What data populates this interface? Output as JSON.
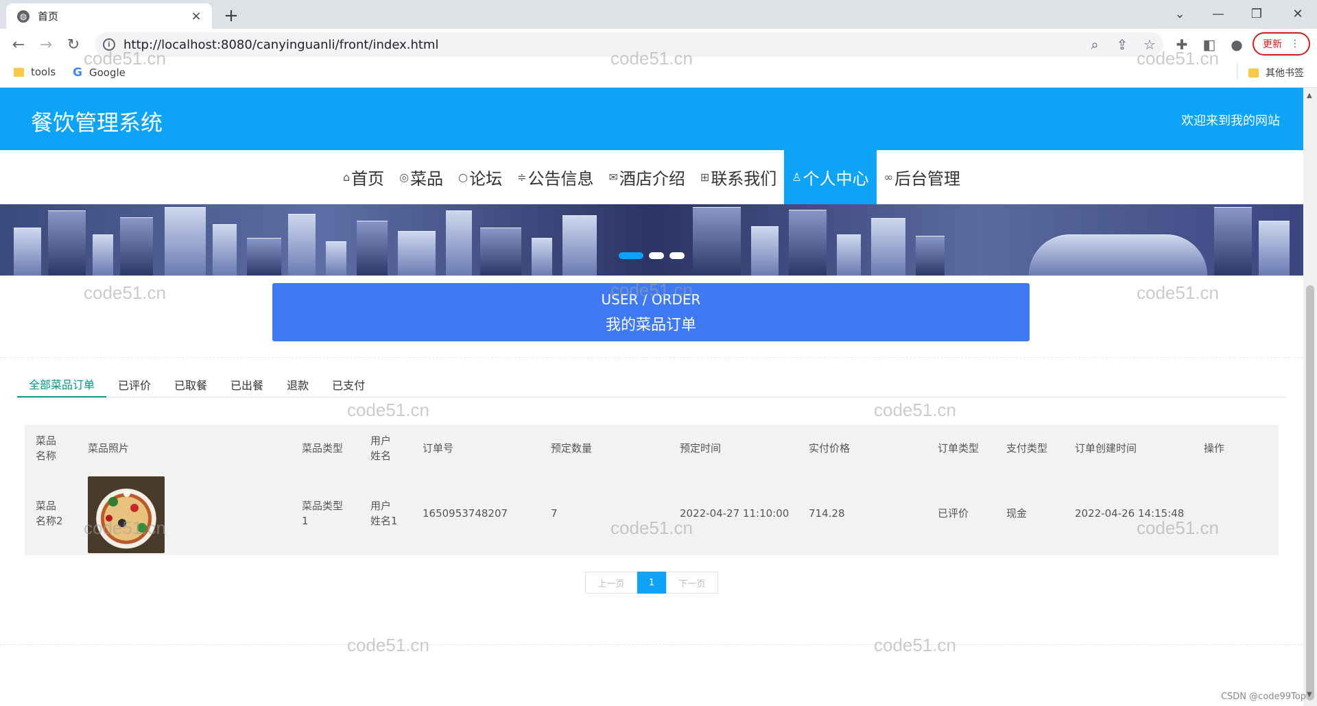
{
  "browser": {
    "tab_title": "首页",
    "tab_close": "×",
    "new_tab": "+",
    "url": "http://localhost:8080/canyinguanli/front/index.html",
    "update_label": "更新",
    "bookmarks": [
      {
        "label": "tools",
        "icon": "folder-icon"
      },
      {
        "label": "Google",
        "icon": "google-icon"
      }
    ],
    "other_bookmarks": "其他书签"
  },
  "site": {
    "title": "餐饮管理系统",
    "welcome": "欢迎来到我的网站",
    "nav": [
      {
        "icon": "⌂",
        "label": "首页",
        "name": "nav-home"
      },
      {
        "icon": "◎",
        "label": "菜品",
        "name": "nav-dishes"
      },
      {
        "icon": "○",
        "label": "论坛",
        "name": "nav-forum"
      },
      {
        "icon": "≑",
        "label": "公告信息",
        "name": "nav-announcements"
      },
      {
        "icon": "✉",
        "label": "酒店介绍",
        "name": "nav-hotel-intro"
      },
      {
        "icon": "⊞",
        "label": "联系我们",
        "name": "nav-contact"
      },
      {
        "icon": "♙",
        "label": "个人中心",
        "name": "nav-personal-center"
      },
      {
        "icon": "∞",
        "label": "后台管理",
        "name": "nav-admin"
      }
    ],
    "active_nav": "个人中心",
    "carousel_dots": 3,
    "carousel_active": 1
  },
  "order_header": {
    "en": "USER / ORDER",
    "cn": "我的菜品订单"
  },
  "tabs": [
    "全部菜品订单",
    "已评价",
    "已取餐",
    "已出餐",
    "退款",
    "已支付"
  ],
  "active_tab": "全部菜品订单",
  "table": {
    "headers": {
      "name": "菜品\n名称",
      "photo": "菜品照片",
      "type": "菜品类型",
      "user": "用户\n姓名",
      "order_no": "订单号",
      "qty": "预定数量",
      "time": "预定时间",
      "price": "实付价格",
      "order_type": "订单类型",
      "pay_type": "支付类型",
      "created": "订单创建时间",
      "action": "操作"
    },
    "rows": [
      {
        "name": "菜品\n名称2",
        "type": "菜品类型\n1",
        "user": "用户\n姓名1",
        "order_no": "1650953748207",
        "qty": "7",
        "time": "2022-04-27 11:10:00",
        "price": "714.28",
        "order_type": "已评价",
        "pay_type": "现金",
        "created": "2022-04-26 14:15:48"
      }
    ]
  },
  "pager": {
    "prev": "上一页",
    "current": "1",
    "next": "下一页"
  },
  "watermark": "code51.cn",
  "credit": "CSDN @code99Top"
}
